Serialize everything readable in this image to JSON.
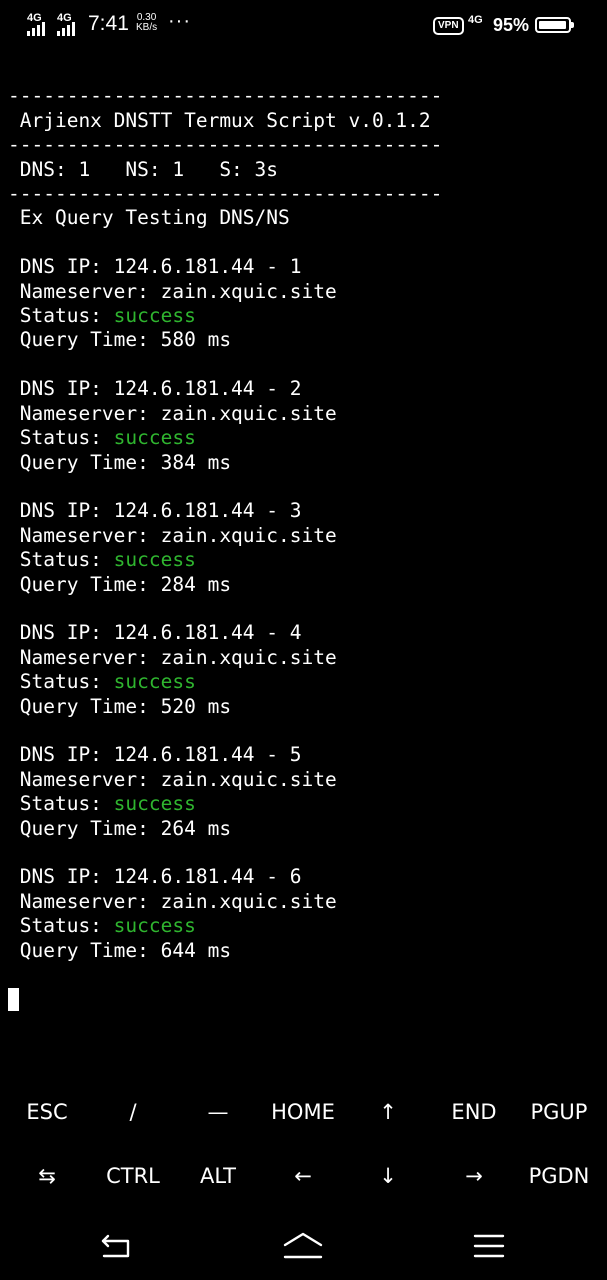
{
  "status_bar": {
    "signal1_label": "4G",
    "signal2_label": "4G",
    "time": "7:41",
    "net_speed_value": "0.30",
    "net_speed_unit": "KB/s",
    "more_indicator": "···",
    "vpn_label": "VPN",
    "network_label": "4G",
    "battery_percent": "95%",
    "battery_level": 0.95
  },
  "terminal": {
    "divider": "-------------------------------------",
    "title": " Arjienx DNSTT Termux Script v.0.1.2",
    "summary": " DNS: 1   NS: 1   S: 3s",
    "section_title": " Ex Query Testing DNS/NS",
    "results": [
      {
        "dns_ip": " DNS IP: 124.6.181.44 - 1",
        "nameserver": " Nameserver: zain.xquic.site",
        "status_label": " Status: ",
        "status_value": "success",
        "query_time": " Query Time: 580 ms"
      },
      {
        "dns_ip": " DNS IP: 124.6.181.44 - 2",
        "nameserver": " Nameserver: zain.xquic.site",
        "status_label": " Status: ",
        "status_value": "success",
        "query_time": " Query Time: 384 ms"
      },
      {
        "dns_ip": " DNS IP: 124.6.181.44 - 3",
        "nameserver": " Nameserver: zain.xquic.site",
        "status_label": " Status: ",
        "status_value": "success",
        "query_time": " Query Time: 284 ms"
      },
      {
        "dns_ip": " DNS IP: 124.6.181.44 - 4",
        "nameserver": " Nameserver: zain.xquic.site",
        "status_label": " Status: ",
        "status_value": "success",
        "query_time": " Query Time: 520 ms"
      },
      {
        "dns_ip": " DNS IP: 124.6.181.44 - 5",
        "nameserver": " Nameserver: zain.xquic.site",
        "status_label": " Status: ",
        "status_value": "success",
        "query_time": " Query Time: 264 ms"
      },
      {
        "dns_ip": " DNS IP: 124.6.181.44 - 6",
        "nameserver": " Nameserver: zain.xquic.site",
        "status_label": " Status: ",
        "status_value": "success",
        "query_time": " Query Time: 644 ms"
      }
    ],
    "success_color": "#2fb52f"
  },
  "extra_keys": {
    "row1": [
      "ESC",
      "/",
      "—",
      "HOME",
      "↑",
      "END",
      "PGUP"
    ],
    "row2": [
      "⇆",
      "CTRL",
      "ALT",
      "←",
      "↓",
      "→",
      "PGDN"
    ]
  },
  "nav_bar": {
    "icons": [
      "back-icon",
      "home-icon",
      "menu-icon"
    ]
  }
}
